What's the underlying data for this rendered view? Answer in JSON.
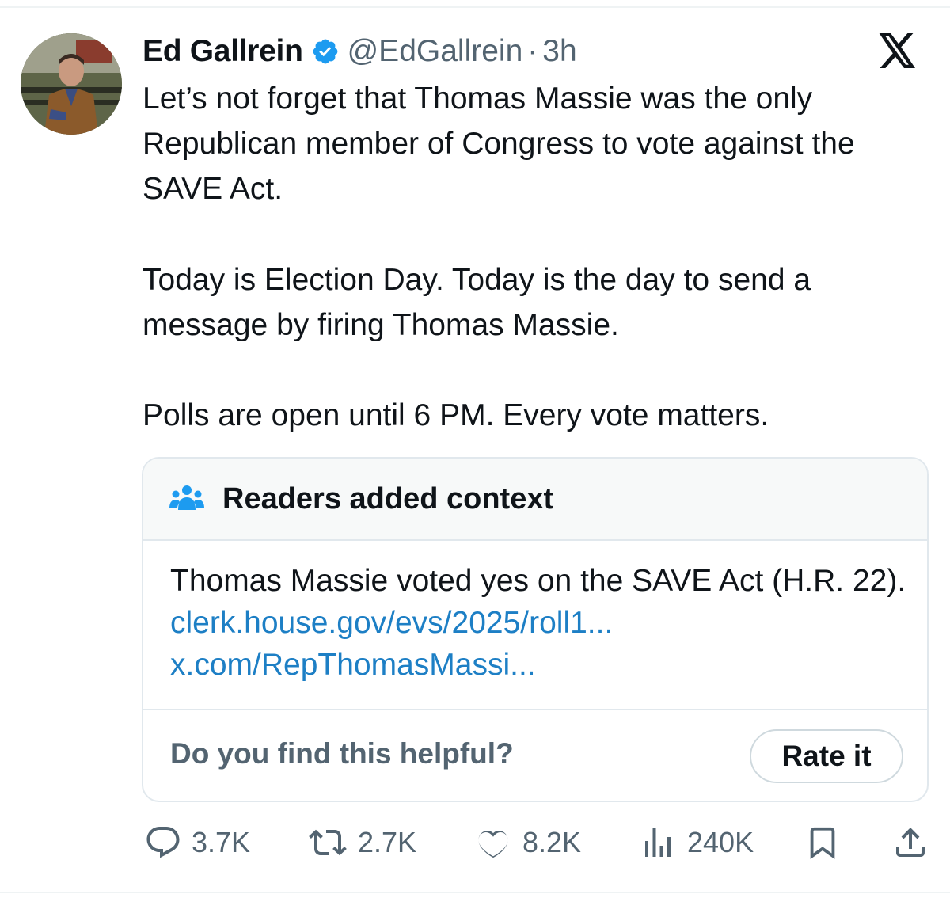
{
  "post": {
    "author_name": "Ed Gallrein",
    "handle": "@EdGallrein",
    "separator": "·",
    "time": "3h",
    "paragraphs": [
      "Let’s not forget that Thomas Massie was the only Republican member of Congress to vote against the SAVE Act.",
      "Today is Election Day. Today is the day to send a message by firing Thomas Massie.",
      "Polls are open until 6 PM. Every vote matters."
    ]
  },
  "community_note": {
    "title": "Readers added context",
    "text": "Thomas Massie voted yes on the SAVE Act (H.R. 22).",
    "links": [
      "clerk.house.gov/evs/2025/roll1...",
      "x.com/RepThomasMassi..."
    ],
    "question": "Do you find this helpful?",
    "rate_label": "Rate it"
  },
  "actions": {
    "replies": "3.7K",
    "reposts": "2.7K",
    "likes": "8.2K",
    "views": "240K"
  },
  "icons": {
    "verified": "verified-badge-icon",
    "brand": "x-logo-icon",
    "reply": "reply-icon",
    "repost": "repost-icon",
    "like": "heart-icon",
    "views": "views-icon",
    "bookmark": "bookmark-icon",
    "share": "share-icon"
  },
  "colors": {
    "accent_blue": "#1d9bf0",
    "link_blue": "#1d7fc5",
    "secondary_text": "#536471",
    "primary_text": "#0f1419"
  }
}
